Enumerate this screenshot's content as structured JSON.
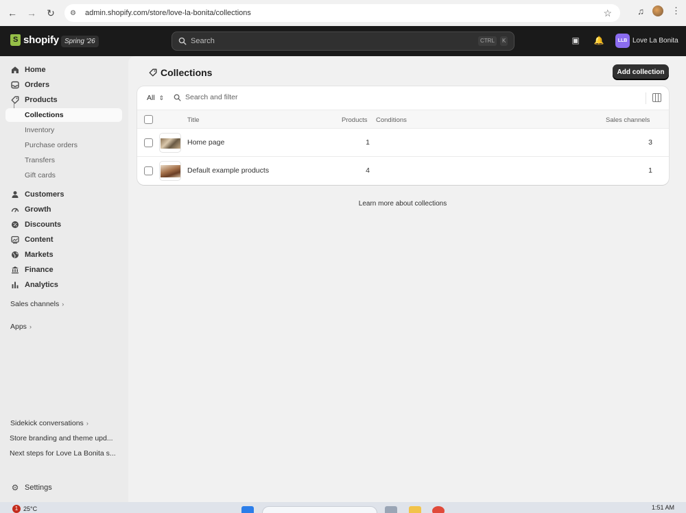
{
  "browser": {
    "url": "admin.shopify.com/store/love-la-bonita/collections",
    "back_icon": "back-arrow-icon",
    "forward_icon": "forward-arrow-icon",
    "reload_icon": "reload-icon"
  },
  "topbar": {
    "brand": "shopify",
    "edition": "Spring '26",
    "search_placeholder": "Search",
    "shortcut_ctrl": "CTRL",
    "shortcut_key": "K",
    "store_initials": "LLB",
    "store_name": "Love La Bonita"
  },
  "sidebar": {
    "items": [
      {
        "label": "Home",
        "icon": "home-icon"
      },
      {
        "label": "Orders",
        "icon": "inbox-icon"
      },
      {
        "label": "Products",
        "icon": "tag-icon"
      },
      {
        "label": "Collections"
      },
      {
        "label": "Inventory"
      },
      {
        "label": "Purchase orders"
      },
      {
        "label": "Transfers"
      },
      {
        "label": "Gift cards"
      },
      {
        "label": "Customers",
        "icon": "person-icon"
      },
      {
        "label": "Growth",
        "icon": "gauge-icon"
      },
      {
        "label": "Discounts",
        "icon": "discount-icon"
      },
      {
        "label": "Content",
        "icon": "image-icon"
      },
      {
        "label": "Markets",
        "icon": "globe-icon"
      },
      {
        "label": "Finance",
        "icon": "bank-icon"
      },
      {
        "label": "Analytics",
        "icon": "bar-chart-icon"
      }
    ],
    "sales_channels": "Sales channels",
    "apps": "Apps",
    "sidekick": "Sidekick conversations",
    "conversations": [
      "Store branding and theme upd...",
      "Next steps for Love La Bonita s..."
    ],
    "settings": "Settings"
  },
  "main": {
    "title": "Collections",
    "add_button": "Add collection",
    "filter_all": "All",
    "filter_placeholder": "Search and filter",
    "columns": {
      "title": "Title",
      "products": "Products",
      "conditions": "Conditions",
      "sales_channels": "Sales channels"
    },
    "rows": [
      {
        "title": "Home page",
        "products": "1",
        "conditions": "",
        "sales_channels": "3"
      },
      {
        "title": "Default example products",
        "products": "4",
        "conditions": "",
        "sales_channels": "1"
      }
    ],
    "learn_more": "Learn more about collections"
  },
  "taskbar": {
    "weather_badge": "1",
    "temperature": "25°C",
    "time": "1:51 AM"
  },
  "colors": {
    "topbar_bg": "#1a1a1a",
    "accent_green": "#95bf47",
    "store_avatar": "#8b6cf0",
    "primary_button": "#303030"
  }
}
